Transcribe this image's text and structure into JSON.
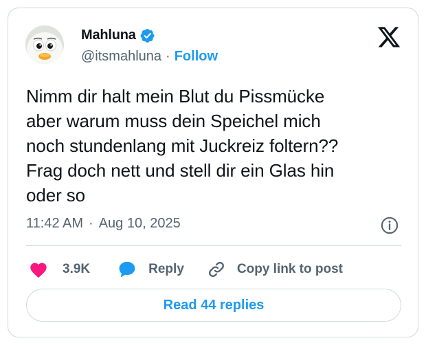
{
  "author": {
    "display_name": "Mahluna",
    "handle": "@itsmahluna",
    "separator": "·",
    "follow_label": "Follow"
  },
  "tweet": {
    "lines": [
      "Nimm dir halt mein Blut du Pissmücke",
      "aber warum muss dein Speichel mich",
      "noch stundenlang mit Juckreiz foltern??",
      "Frag doch nett und stell dir ein Glas hin",
      "oder so"
    ],
    "time": "11:42 AM",
    "separator": "·",
    "date": "Aug 10, 2025"
  },
  "actions": {
    "likes": "3.9K",
    "reply_label": "Reply",
    "copy_link_label": "Copy link to post"
  },
  "footer": {
    "read_replies_label": "Read 44 replies"
  },
  "icons": {
    "brand": "x-logo-icon",
    "verified": "verified-badge-icon",
    "info": "info-icon",
    "like": "heart-icon",
    "reply": "speech-bubble-icon",
    "copy": "link-icon"
  },
  "colors": {
    "accent": "#1d9bf0",
    "like": "#f91880",
    "text": "#0f1419",
    "muted": "#536471",
    "border": "#cfd9de"
  }
}
